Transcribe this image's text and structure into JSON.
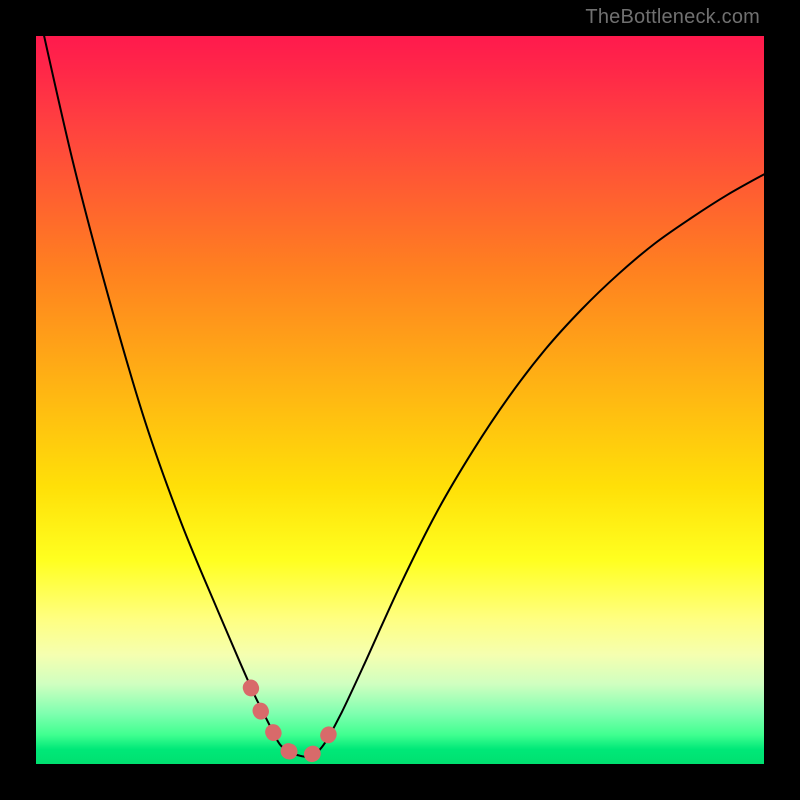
{
  "watermark": "TheBottleneck.com",
  "chart_data": {
    "type": "line",
    "title": "",
    "xlabel": "",
    "ylabel": "",
    "series": [
      {
        "name": "curve",
        "x": [
          0.0,
          0.05,
          0.1,
          0.15,
          0.2,
          0.25,
          0.28,
          0.3,
          0.31,
          0.32,
          0.325,
          0.33,
          0.335,
          0.34,
          0.35,
          0.36,
          0.37,
          0.38,
          0.39,
          0.4,
          0.42,
          0.45,
          0.5,
          0.55,
          0.6,
          0.65,
          0.7,
          0.75,
          0.8,
          0.85,
          0.9,
          0.95,
          1.0
        ],
        "y": [
          1.05,
          0.83,
          0.64,
          0.47,
          0.33,
          0.21,
          0.14,
          0.095,
          0.075,
          0.055,
          0.045,
          0.035,
          0.027,
          0.022,
          0.015,
          0.012,
          0.01,
          0.012,
          0.02,
          0.034,
          0.071,
          0.135,
          0.245,
          0.345,
          0.43,
          0.505,
          0.57,
          0.625,
          0.673,
          0.715,
          0.75,
          0.782,
          0.81
        ]
      },
      {
        "name": "highlight",
        "color": "#d86a6a",
        "stroke_width": 16,
        "dash": "1 24",
        "x": [
          0.295,
          0.31,
          0.325,
          0.34,
          0.355,
          0.37,
          0.387,
          0.405
        ],
        "y": [
          0.105,
          0.07,
          0.045,
          0.022,
          0.015,
          0.01,
          0.02,
          0.045
        ]
      }
    ],
    "xlim": [
      0.0,
      1.0
    ],
    "ylim": [
      0.0,
      1.0
    ],
    "background_gradient": {
      "top": "#ff1a4d",
      "mid": "#ffe008",
      "bottom": "#00e070"
    }
  }
}
